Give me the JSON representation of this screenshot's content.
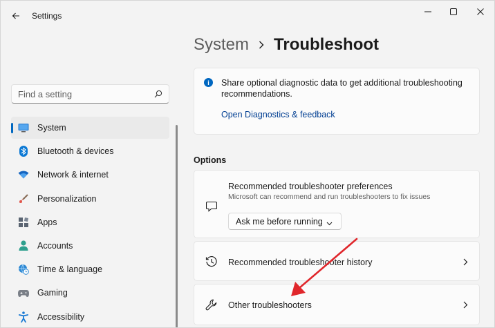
{
  "window": {
    "title": "Settings"
  },
  "sidebar": {
    "search_placeholder": "Find a setting",
    "items": [
      {
        "label": "System",
        "icon": "monitor-icon",
        "active": true
      },
      {
        "label": "Bluetooth & devices",
        "icon": "bluetooth-icon"
      },
      {
        "label": "Network & internet",
        "icon": "wifi-icon"
      },
      {
        "label": "Personalization",
        "icon": "brush-icon"
      },
      {
        "label": "Apps",
        "icon": "apps-icon"
      },
      {
        "label": "Accounts",
        "icon": "person-icon"
      },
      {
        "label": "Time & language",
        "icon": "globe-clock-icon"
      },
      {
        "label": "Gaming",
        "icon": "gamepad-icon"
      },
      {
        "label": "Accessibility",
        "icon": "accessibility-icon"
      }
    ]
  },
  "breadcrumb": {
    "parent": "System",
    "current": "Troubleshoot"
  },
  "info_card": {
    "text": "Share optional diagnostic data to get additional troubleshooting recommendations.",
    "link": "Open Diagnostics & feedback"
  },
  "options": {
    "section_title": "Options",
    "preferences": {
      "title": "Recommended troubleshooter preferences",
      "description": "Microsoft can recommend and run troubleshooters to fix issues",
      "dropdown_value": "Ask me before running"
    },
    "history": {
      "label": "Recommended troubleshooter history"
    },
    "other": {
      "label": "Other troubleshooters"
    }
  },
  "colors": {
    "accent": "#0067c0",
    "annotation_arrow": "#e0262b"
  }
}
